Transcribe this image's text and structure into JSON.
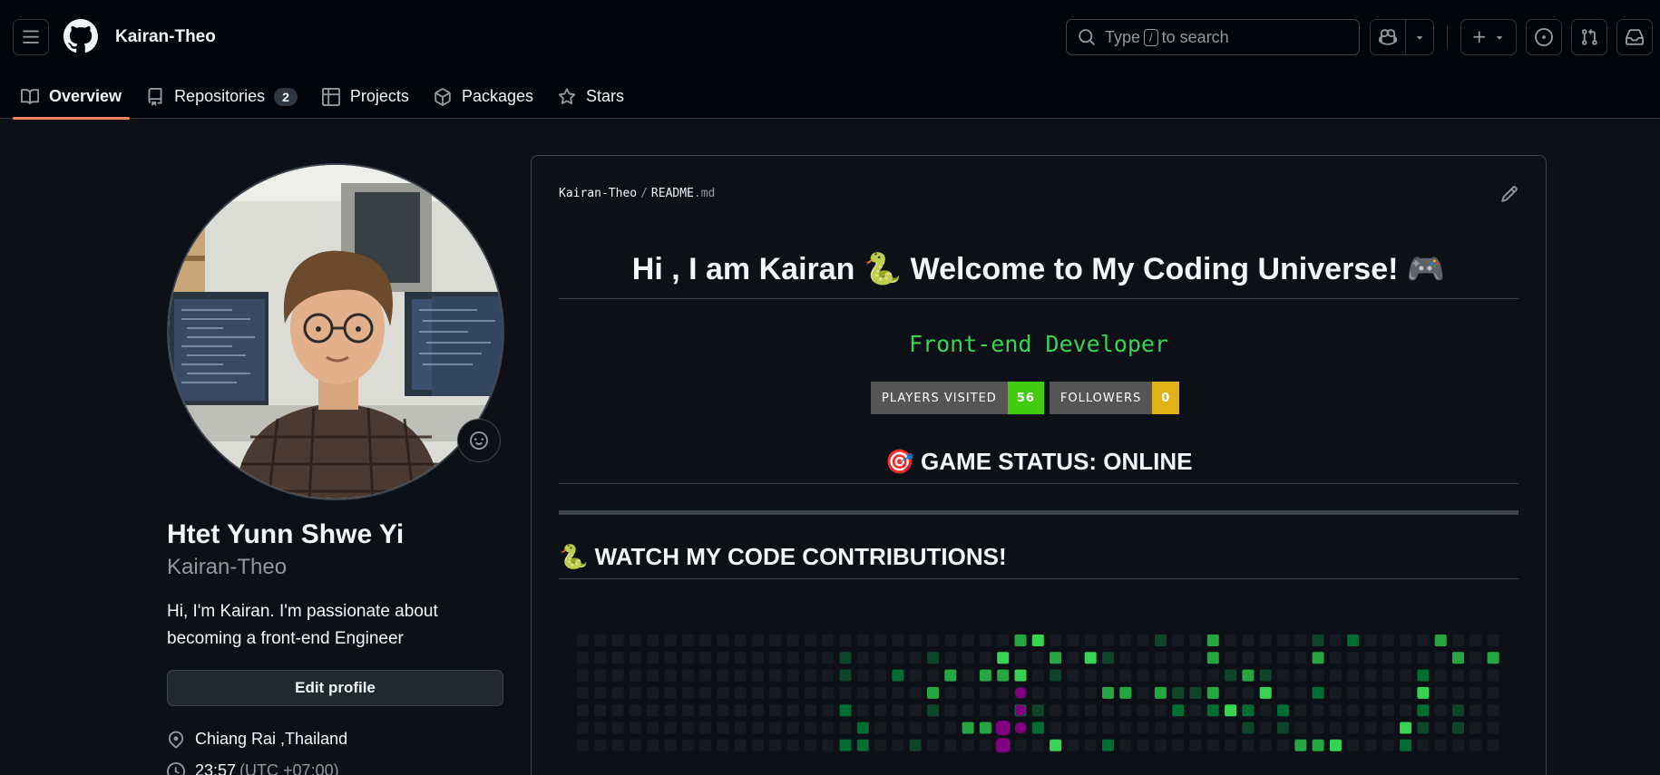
{
  "header": {
    "username": "Kairan-Theo",
    "search": {
      "prefix": "Type",
      "key": "/",
      "suffix": "to search"
    }
  },
  "tabs": [
    {
      "label": "Overview",
      "icon": "book-icon",
      "active": true
    },
    {
      "label": "Repositories",
      "icon": "repo-icon",
      "count": "2"
    },
    {
      "label": "Projects",
      "icon": "table-icon"
    },
    {
      "label": "Packages",
      "icon": "package-icon"
    },
    {
      "label": "Stars",
      "icon": "star-icon"
    }
  ],
  "profile": {
    "full_name": "Htet Yunn Shwe Yi",
    "login": "Kairan-Theo",
    "bio": "Hi, I'm Kairan. I'm passionate about becoming a front-end Engineer",
    "edit_label": "Edit profile",
    "location": "Chiang Rai ,Thailand",
    "time": "23:57",
    "timezone": "(UTC +07:00)"
  },
  "readme": {
    "path_owner": "Kairan-Theo",
    "path_sep": "/",
    "path_file": "README",
    "path_ext": ".md",
    "heading": "Hi , I am Kairan 🐍 Welcome to My Coding Universe! 🎮",
    "typing_text": "Front-end Developer",
    "badges": [
      {
        "label": "PLAYERS VISITED",
        "value": "56",
        "color": "#4c1"
      },
      {
        "label": "FOLLOWERS",
        "value": "0",
        "color": "#dfb317"
      }
    ],
    "status_heading": "🎯 GAME STATUS: ONLINE",
    "contrib_heading": "🐍 WATCH MY CODE CONTRIBUTIONS!"
  },
  "colors": {
    "accent_tab": "#f78166",
    "bg": "#0d1117",
    "header_bg": "#010409",
    "contrib_levels": [
      "#161b22",
      "#0e4429",
      "#006d32",
      "#26a641",
      "#39d353"
    ],
    "snake": "#800080"
  }
}
